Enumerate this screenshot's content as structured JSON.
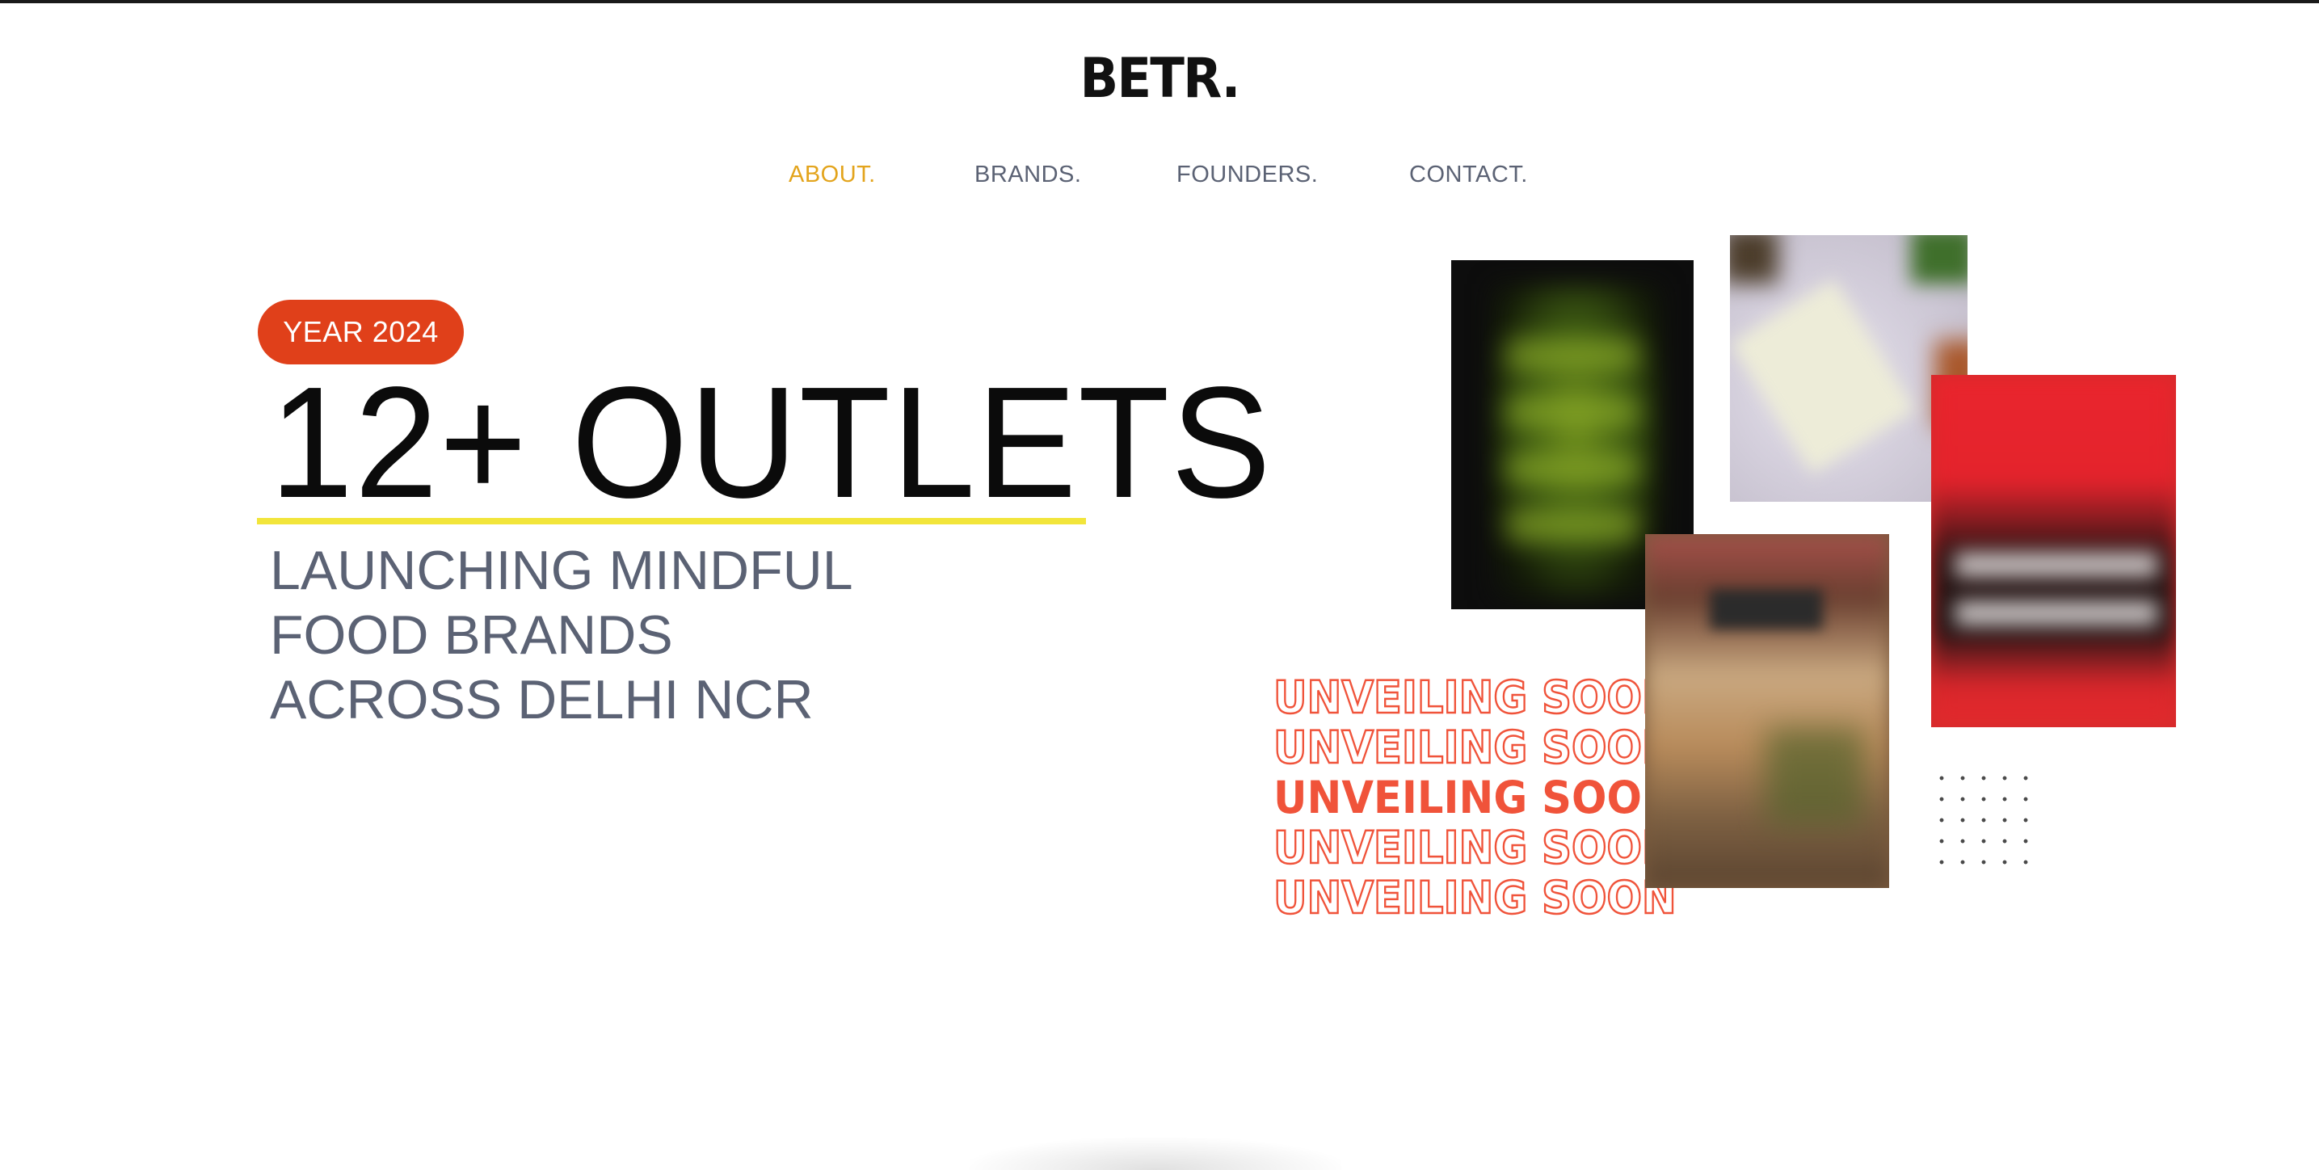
{
  "brand": {
    "logo_text": "BETR."
  },
  "nav": {
    "items": [
      {
        "label": "ABOUT.",
        "active": true
      },
      {
        "label": "BRANDS.",
        "active": false
      },
      {
        "label": "FOUNDERS.",
        "active": false
      },
      {
        "label": "CONTACT.",
        "active": false
      }
    ]
  },
  "hero": {
    "badge": "YEAR 2024",
    "headline": "12+ OUTLETS",
    "subheading_lines": [
      "LAUNCHING MINDFUL",
      "FOOD BRANDS",
      "ACROSS DELHI NCR"
    ]
  },
  "teaser": {
    "lines": [
      "UNVEILING SOON",
      "UNVEILING SOON",
      "UNVEILING SOON",
      "UNVEILING SOON",
      "UNVEILING SOON"
    ],
    "highlight_index": 2
  },
  "colors": {
    "accent_active_nav": "#e3a41c",
    "badge_bg": "#e0401a",
    "underline": "#f2e53b",
    "teaser": "#f0533a",
    "muted_text": "#5b6274"
  }
}
